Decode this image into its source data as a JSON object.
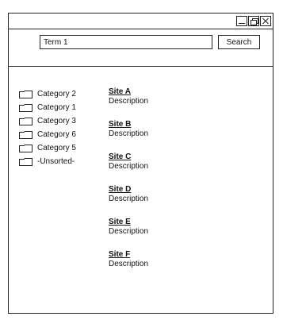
{
  "search": {
    "value": "Term 1",
    "button_label": "Search"
  },
  "categories": [
    {
      "label": "Category 2"
    },
    {
      "label": "Category 1"
    },
    {
      "label": "Category 3"
    },
    {
      "label": "Category 6"
    },
    {
      "label": "Category 5"
    },
    {
      "label": "-Unsorted-"
    }
  ],
  "results": [
    {
      "name": "Site A",
      "description": "Description"
    },
    {
      "name": "Site B",
      "description": "Description"
    },
    {
      "name": "Site C",
      "description": "Description"
    },
    {
      "name": "Site D",
      "description": "Description"
    },
    {
      "name": "Site E",
      "description": "Description"
    },
    {
      "name": "Site F",
      "description": "Description"
    }
  ]
}
